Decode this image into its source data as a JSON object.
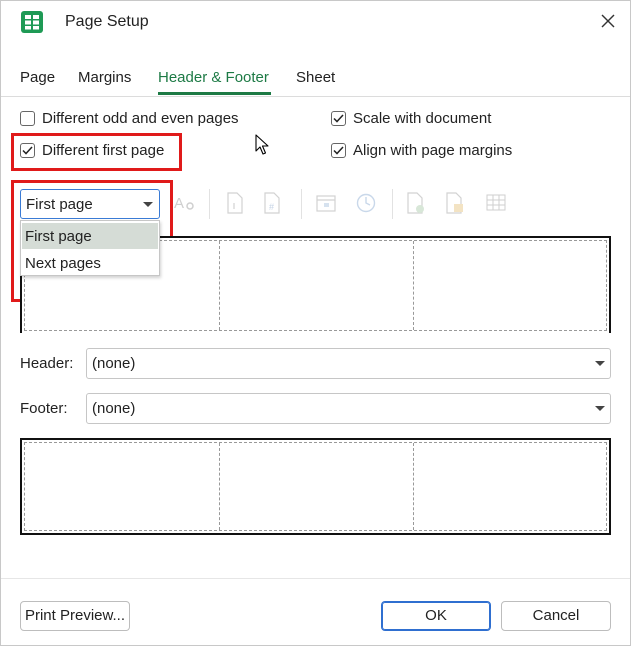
{
  "window": {
    "title": "Page Setup",
    "icon": "spreadsheet-app-icon",
    "accent_color": "#1d7a45"
  },
  "tabs": [
    {
      "label": "Page",
      "active": false
    },
    {
      "label": "Margins",
      "active": false
    },
    {
      "label": "Header & Footer",
      "active": true
    },
    {
      "label": "Sheet",
      "active": false
    }
  ],
  "options": {
    "different_odd_even": {
      "label": "Different odd and even pages",
      "checked": false
    },
    "different_first_page": {
      "label": "Different first page",
      "checked": true
    },
    "scale_with_document": {
      "label": "Scale with document",
      "checked": true
    },
    "align_with_margins": {
      "label": "Align with page margins",
      "checked": true
    }
  },
  "page_select": {
    "value": "First page",
    "options": [
      "First page",
      "Next pages"
    ],
    "highlighted": "First page"
  },
  "toolbar_icons": [
    "font-format-icon",
    "page-number-icon",
    "page-count-icon",
    "date-icon",
    "time-icon",
    "file-path-icon",
    "file-name-icon",
    "sheet-name-icon"
  ],
  "header": {
    "label": "Header:",
    "value": "(none)"
  },
  "footer": {
    "label": "Footer:",
    "value": "(none)"
  },
  "buttons": {
    "print_preview": "Print Preview...",
    "ok": "OK",
    "cancel": "Cancel"
  },
  "annotation_color": "#e01a1a"
}
